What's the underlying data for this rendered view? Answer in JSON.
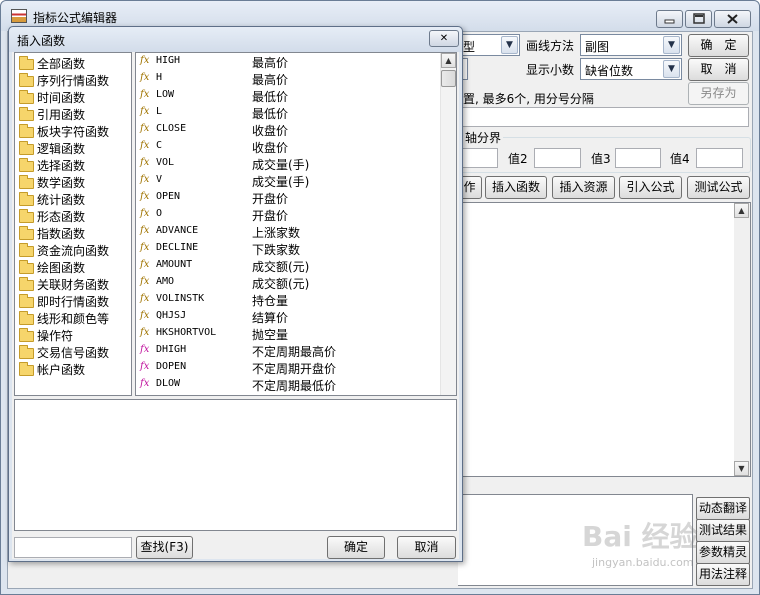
{
  "main_window": {
    "title": "指标公式编辑器",
    "partial_type_text": "型",
    "draw_method_label": "画线方法",
    "draw_method_value": "副图",
    "decimals_label": "显示小数",
    "decimals_value": "缺省位数",
    "ok": "确　定",
    "cancel": "取　消",
    "save_as": "另存为",
    "hint_text": "置, 最多6个, 用分号分隔",
    "axis_group_label": "轴分界",
    "value2_label": "值2",
    "value3_label": "值3",
    "value4_label": "值4",
    "toolbar": {
      "partial_button": "作",
      "insert_function": "插入函数",
      "insert_resource": "插入资源",
      "import_formula": "引入公式",
      "test_formula": "测试公式"
    },
    "side_buttons": [
      "动态翻译",
      "测试结果",
      "参数精灵",
      "用法注释"
    ]
  },
  "dialog": {
    "title": "插入函数",
    "close_glyph": "✕",
    "categories": [
      "全部函数",
      "序列行情函数",
      "时间函数",
      "引用函数",
      "板块字符函数",
      "逻辑函数",
      "选择函数",
      "数学函数",
      "统计函数",
      "形态函数",
      "指数函数",
      "资金流向函数",
      "绘图函数",
      "关联财务函数",
      "即时行情函数",
      "线形和颜色等",
      "操作符",
      "交易信号函数",
      "帐户函数"
    ],
    "fx_glyph": "fx",
    "functions": [
      {
        "name": "HIGH",
        "desc": "最高价",
        "magenta": false
      },
      {
        "name": "H",
        "desc": "最高价",
        "magenta": false
      },
      {
        "name": "LOW",
        "desc": "最低价",
        "magenta": false
      },
      {
        "name": "L",
        "desc": "最低价",
        "magenta": false
      },
      {
        "name": "CLOSE",
        "desc": "收盘价",
        "magenta": false
      },
      {
        "name": "C",
        "desc": "收盘价",
        "magenta": false
      },
      {
        "name": "VOL",
        "desc": "成交量(手)",
        "magenta": false
      },
      {
        "name": "V",
        "desc": "成交量(手)",
        "magenta": false
      },
      {
        "name": "OPEN",
        "desc": "开盘价",
        "magenta": false
      },
      {
        "name": "O",
        "desc": "开盘价",
        "magenta": false
      },
      {
        "name": "ADVANCE",
        "desc": "上涨家数",
        "magenta": false
      },
      {
        "name": "DECLINE",
        "desc": "下跌家数",
        "magenta": false
      },
      {
        "name": "AMOUNT",
        "desc": "成交额(元)",
        "magenta": false
      },
      {
        "name": "AMO",
        "desc": "成交额(元)",
        "magenta": false
      },
      {
        "name": "VOLINSTK",
        "desc": "持仓量",
        "magenta": false
      },
      {
        "name": "QHJSJ",
        "desc": "结算价",
        "magenta": false
      },
      {
        "name": "HKSHORTVOL",
        "desc": "抛空量",
        "magenta": false
      },
      {
        "name": "DHIGH",
        "desc": "不定周期最高价",
        "magenta": true
      },
      {
        "name": "DOPEN",
        "desc": "不定周期开盘价",
        "magenta": true
      },
      {
        "name": "DLOW",
        "desc": "不定周期最低价",
        "magenta": true
      }
    ],
    "search_value": "",
    "find_button": "查找(F3)",
    "ok": "确定",
    "cancel": "取消"
  },
  "watermark": {
    "brand": "Bai 经验",
    "url": "jingyan.baidu.com"
  },
  "icons": {
    "arrow_down": "▼",
    "arrow_up": "▲"
  },
  "colors": {
    "fx_normal": "#a07400",
    "fx_magenta": "#c0159e",
    "title_bar": "#dde5ef"
  }
}
